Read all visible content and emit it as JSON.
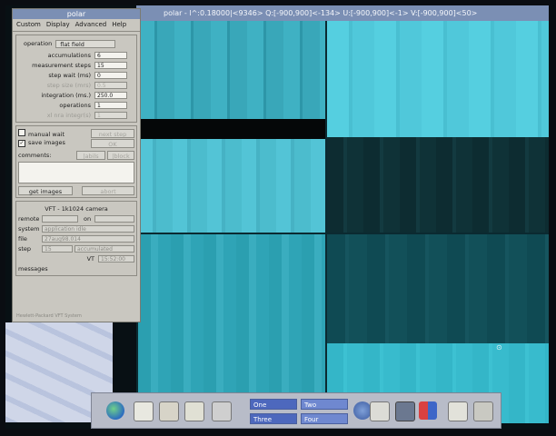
{
  "image_window": {
    "title": "polar - l^:0.18000|<9346> Q:[-900,900]<-134> U:[-900,900]<-1> V:[-900,900]<50>"
  },
  "panel": {
    "title": "polar",
    "menu": [
      "Custom",
      "Display",
      "Advanced",
      "Help"
    ],
    "operation_label": "operation",
    "operation_value": "flat field",
    "fields": [
      {
        "label": "accumulations",
        "value": "6",
        "enabled": true
      },
      {
        "label": "measurement steps",
        "value": "15",
        "enabled": true
      },
      {
        "label": "step wait (ms)",
        "value": "0",
        "enabled": true
      },
      {
        "label": "step size (mrs)",
        "value": "0.5",
        "enabled": false
      },
      {
        "label": "integration (ms.)",
        "value": "250.0",
        "enabled": true
      },
      {
        "label": "operations",
        "value": "1",
        "enabled": true
      },
      {
        "label": "xl nra integr(s)",
        "value": "1",
        "enabled": false
      }
    ],
    "manual_wait_label": "manual wait",
    "next_step_label": "next step",
    "save_images_label": "save images",
    "save_images_checked": true,
    "save_button_label": "OK",
    "comments_label": "comments:",
    "button_a": "|abils",
    "button_b": "|block",
    "get_images_label": "get images",
    "abort_label": "abort",
    "camera_title": "VFT  -  1k1024 camera",
    "status": {
      "remote_label": "remote",
      "remote_value": "",
      "on_label": "on",
      "system_label": "system",
      "system_value": "application idle",
      "file_label": "file",
      "file_value": "27aug98.014",
      "step_label": "step",
      "step_value": "15",
      "step_state": "accumulated",
      "vt_label": "VT",
      "vt_value": "15:52:00",
      "messages_label": "messages"
    },
    "footer_note": "Hewlett-Packard VFT System"
  },
  "dock": {
    "workspaces": [
      {
        "label": "One",
        "active": true
      },
      {
        "label": "Two",
        "active": false
      },
      {
        "label": "Three",
        "active": true
      },
      {
        "label": "Four",
        "active": false
      }
    ]
  },
  "colors": {
    "titlebar": "#7b8fb4",
    "panel_bg": "#c9c7c0",
    "workspace": "#6f88d0"
  }
}
